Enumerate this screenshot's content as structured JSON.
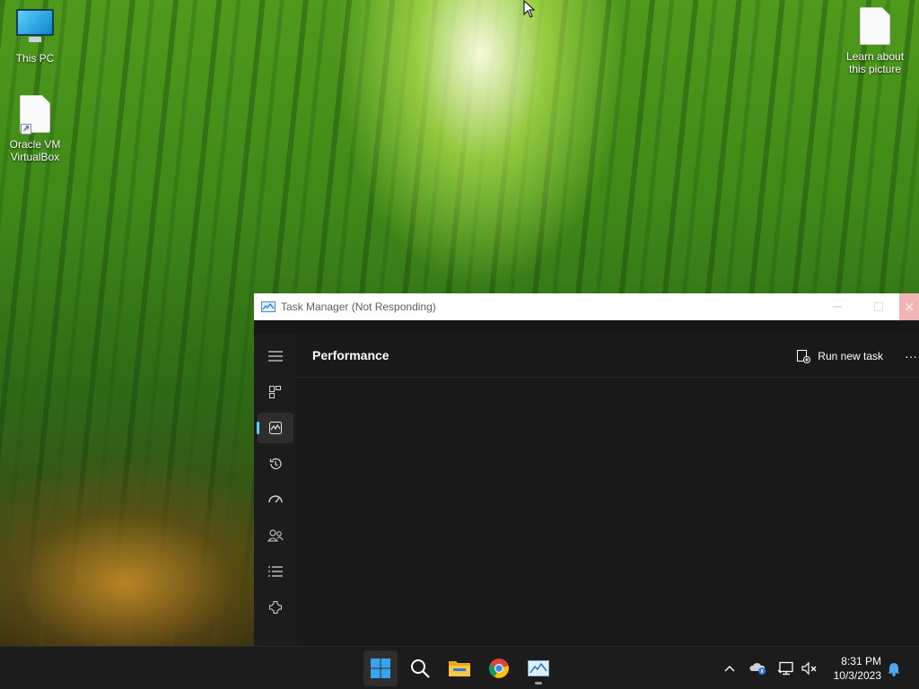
{
  "desktop": {
    "icons": [
      {
        "label_line1": "This PC",
        "label_line2": "",
        "icon": "monitor-icon"
      },
      {
        "label_line1": "Oracle VM",
        "label_line2": "VirtualBox",
        "icon": "shortcut-file-icon"
      },
      {
        "label_line1": "Learn about",
        "label_line2": "this picture",
        "icon": "file-icon"
      }
    ]
  },
  "task_manager": {
    "title": "Task Manager (Not Responding)",
    "page_title": "Performance",
    "run_new_task_label": "Run new task",
    "more_label": "···",
    "nav": [
      {
        "name": "menu",
        "icon": "hamburger-icon"
      },
      {
        "name": "processes",
        "icon": "processes-icon"
      },
      {
        "name": "performance",
        "icon": "performance-icon",
        "active": true
      },
      {
        "name": "app-history",
        "icon": "history-icon"
      },
      {
        "name": "startup-apps",
        "icon": "startup-icon"
      },
      {
        "name": "users",
        "icon": "users-icon"
      },
      {
        "name": "details",
        "icon": "list-icon"
      },
      {
        "name": "services",
        "icon": "services-icon"
      }
    ],
    "accent_color": "#60cdff"
  },
  "taskbar": {
    "apps": [
      "start-icon",
      "search-icon",
      "file-explorer-icon",
      "chrome-icon",
      "task-manager-icon"
    ],
    "clock": {
      "time": "8:31 PM",
      "date": "10/3/2023"
    },
    "tray": [
      "chevron-up-icon",
      "onedrive-icon",
      "network-icon",
      "volume-muted-icon",
      "notification-bell-icon"
    ]
  }
}
